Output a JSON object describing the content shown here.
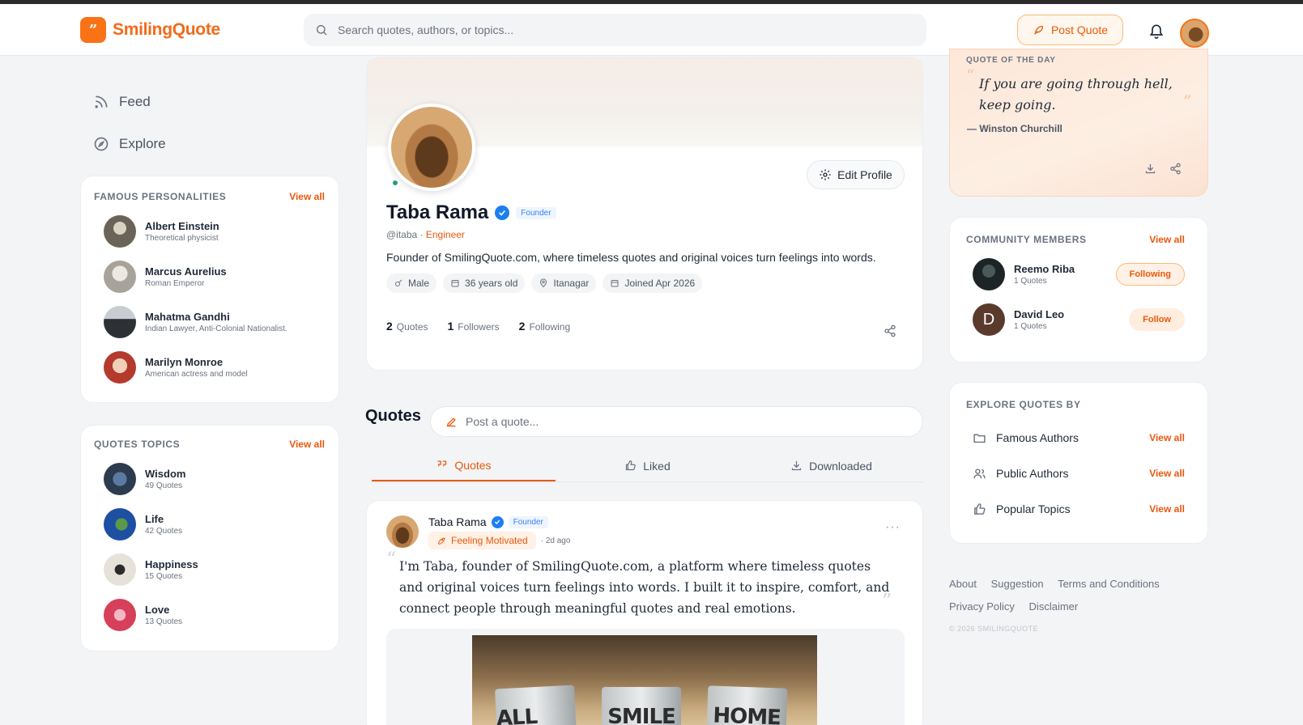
{
  "app": {
    "name": "SmilingQuote",
    "logo_glyph": "”"
  },
  "header": {
    "search_placeholder": "Search quotes, authors, or topics...",
    "post_quote_label": "Post Quote"
  },
  "left_nav": [
    {
      "label": "Feed",
      "icon": "rss-icon"
    },
    {
      "label": "Explore",
      "icon": "compass-icon"
    }
  ],
  "famous_personalities": {
    "title": "FAMOUS PERSONALITIES",
    "view_all": "View all",
    "items": [
      {
        "name": "Albert Einstein",
        "sub": "Theoretical physicist",
        "color": "#6b6357"
      },
      {
        "name": "Marcus Aurelius",
        "sub": "Roman Emperor",
        "color": "#a7a39b"
      },
      {
        "name": "Mahatma Gandhi",
        "sub": "Indian Lawyer, Anti-Colonial Nationalist.",
        "color": "#2d3136"
      },
      {
        "name": "Marilyn Monroe",
        "sub": "American actress and model",
        "color": "#b33a2c"
      }
    ]
  },
  "quotes_topics": {
    "title": "QUOTES TOPICS",
    "view_all": "View all",
    "items": [
      {
        "name": "Wisdom",
        "sub": "49 Quotes",
        "color": "#2c3b4e"
      },
      {
        "name": "Life",
        "sub": "42 Quotes",
        "color": "#1d4fa3"
      },
      {
        "name": "Happiness",
        "sub": "15 Quotes",
        "color": "#e6e2da"
      },
      {
        "name": "Love",
        "sub": "13 Quotes",
        "color": "#d6405a"
      }
    ]
  },
  "profile": {
    "name": "Taba Rama",
    "badge": "Founder",
    "handle": "@itaba · ",
    "role": "Engineer",
    "bio": "Founder of SmilingQuote.com, where timeless quotes and original voices turn feelings into words.",
    "edit_label": "Edit Profile",
    "chips": [
      {
        "label": "Male",
        "icon": "gender-icon"
      },
      {
        "label": "36 years old",
        "icon": "calendar-icon"
      },
      {
        "label": "Itanagar",
        "icon": "location-icon"
      },
      {
        "label": "Joined Apr 2026",
        "icon": "calendar-icon"
      }
    ],
    "stats": [
      {
        "count": "2",
        "label": "Quotes"
      },
      {
        "count": "1",
        "label": "Followers"
      },
      {
        "count": "2",
        "label": "Following"
      }
    ]
  },
  "quotes_section": {
    "title": "Quotes",
    "post_placeholder": "Post a quote...",
    "tabs": [
      {
        "label": "Quotes",
        "icon": "quote-icon",
        "active": true
      },
      {
        "label": "Liked",
        "icon": "thumbs-up-icon",
        "active": false
      },
      {
        "label": "Downloaded",
        "icon": "download-icon",
        "active": false
      }
    ]
  },
  "post": {
    "author": "Taba Rama",
    "badge": "Founder",
    "mood": "Feeling Motivated",
    "time": "· 2d ago",
    "text": "I'm Taba, founder of SmilingQuote.com, a platform where timeless quotes and original voices turn feelings into words. I built it to inspire, comfort, and connect people through meaningful quotes and real emotions.",
    "image_words": [
      "ALL YOU",
      "SMILE",
      "HOME"
    ]
  },
  "quote_of_day": {
    "label": "QUOTE OF THE DAY",
    "text": "If you are going through hell, keep going.",
    "author": "— Winston Churchill"
  },
  "community": {
    "title": "COMMUNITY MEMBERS",
    "view_all": "View all",
    "members": [
      {
        "name": "Reemo Riba",
        "sub": "1 Quotes",
        "button": "Following",
        "state": "following"
      },
      {
        "name": "David Leo",
        "sub": "1 Quotes",
        "button": "Follow",
        "state": "follow",
        "initial": "D"
      }
    ]
  },
  "explore_by": {
    "title": "EXPLORE QUOTES BY",
    "items": [
      {
        "label": "Famous Authors",
        "view_all": "View all",
        "icon": "folder-icon"
      },
      {
        "label": "Public Authors",
        "view_all": "View all",
        "icon": "users-icon"
      },
      {
        "label": "Popular Topics",
        "view_all": "View all",
        "icon": "thumbs-up-icon"
      }
    ]
  },
  "footer": {
    "links": [
      "About",
      "Suggestion",
      "Terms and Conditions",
      "Privacy Policy",
      "Disclaimer"
    ],
    "copyright": "© 2026 SMILINGQUOTE"
  },
  "colors": {
    "accent": "#ea580c",
    "verified": "#1d7ef2",
    "online": "#22a06b"
  }
}
